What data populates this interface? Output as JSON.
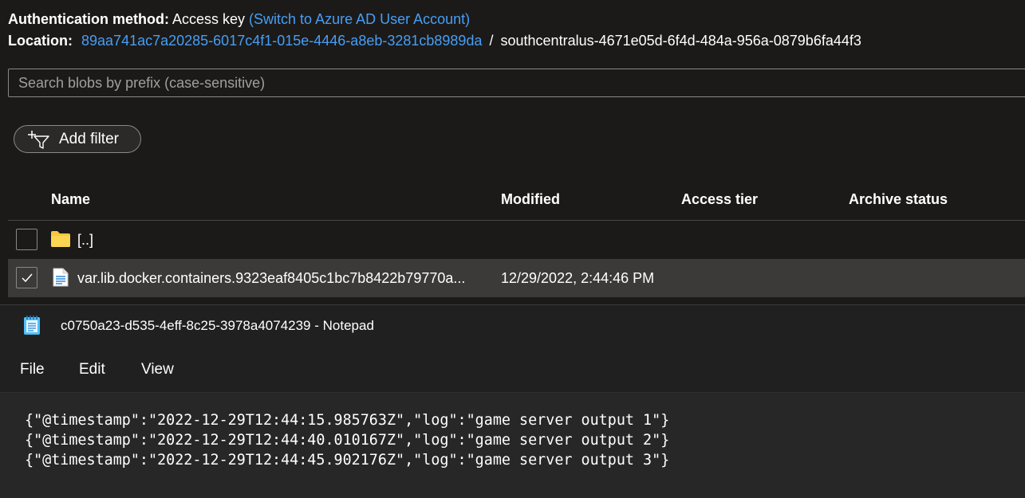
{
  "auth": {
    "label": "Authentication method:",
    "value": "Access key",
    "switch_link": "(Switch to Azure AD User Account)"
  },
  "location": {
    "label": "Location:",
    "container_link": "89aa741ac7a20285-6017c4f1-015e-4446-a8eb-3281cb8989da",
    "separator": "/",
    "path": "southcentralus-4671e05d-6f4d-484a-956a-0879b6fa44f3"
  },
  "search": {
    "placeholder": "Search blobs by prefix (case-sensitive)",
    "value": ""
  },
  "filter": {
    "add_label": "Add filter"
  },
  "table": {
    "columns": [
      "Name",
      "Modified",
      "Access tier",
      "Archive status"
    ],
    "rows": [
      {
        "name": "[..]",
        "modified": "",
        "selected": false,
        "icon": "folder-icon"
      },
      {
        "name": "var.lib.docker.containers.9323eaf8405c1bc7b8422b79770a...",
        "modified": "12/29/2022, 2:44:46 PM",
        "selected": true,
        "icon": "file-icon"
      }
    ]
  },
  "notepad": {
    "title": "c0750a23-d535-4eff-8c25-3978a4074239 - Notepad",
    "menu": [
      "File",
      "Edit",
      "View"
    ],
    "lines": [
      "{\"@timestamp\":\"2022-12-29T12:44:15.985763Z\",\"log\":\"game server output 1\"}",
      "{\"@timestamp\":\"2022-12-29T12:44:40.010167Z\",\"log\":\"game server output 2\"}",
      "{\"@timestamp\":\"2022-12-29T12:44:45.902176Z\",\"log\":\"game server output 3\"}"
    ]
  },
  "colors": {
    "accent": "#479ef5",
    "folder": "#f8c93a",
    "background": "#1b1a19"
  }
}
